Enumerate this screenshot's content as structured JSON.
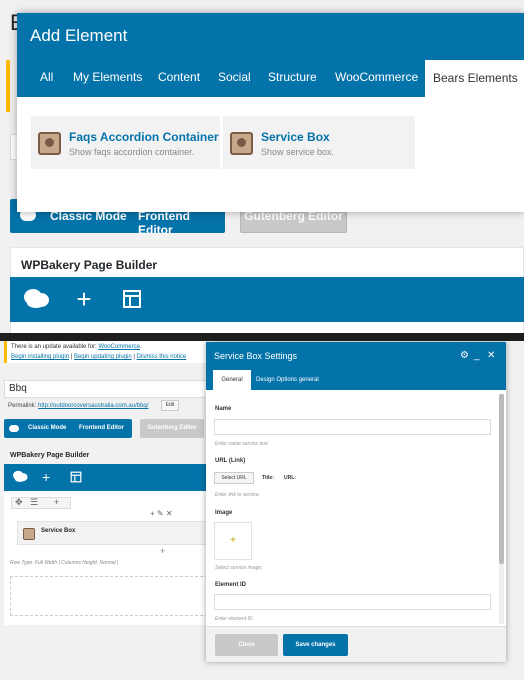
{
  "top": {
    "bg_title": "E",
    "mode_bar": {
      "classic": "Classic Mode",
      "frontend": "Frontend Editor"
    },
    "gutenberg": "Gutenberg Editor",
    "wpbakery_title": "WPBakery Page Builder",
    "toolbar_icons": [
      "cloud-icon",
      "plus-icon",
      "layout-icon"
    ],
    "modal": {
      "title": "Add Element",
      "tabs": [
        "All",
        "My Elements",
        "Content",
        "Social",
        "Structure",
        "WooCommerce",
        "Bears Elements"
      ],
      "active_tab": "Bears Elements",
      "elements": [
        {
          "name": "Faqs Accordion Container",
          "desc": "Show faqs accordion container."
        },
        {
          "name": "Service Box",
          "desc": "Show service box."
        }
      ]
    }
  },
  "bottom": {
    "notice": {
      "line1_prefix": "There is an update available for: ",
      "line1_link": "WooCommerce",
      "line1_suffix": ".",
      "link_install": "Begin installing plugin",
      "link_update": "Begin updating plugin",
      "link_dismiss": "Dismiss this notice"
    },
    "post_title": "Bbq",
    "permalink_label": "Permalink:",
    "permalink_url": "http://outdoorcoversaustralia.com.au/bbq/",
    "edit_label": "Edit",
    "mode_bar": {
      "classic": "Classic Mode",
      "frontend": "Frontend Editor"
    },
    "gutenberg": "Gutenberg Editor",
    "wpbakery_title": "WPBakery Page Builder",
    "element_name": "Service Box",
    "row_info": "Row Type: Full Width | Columns Height: Normal |",
    "dialog": {
      "title": "Service Box Settings",
      "tabs": [
        "General",
        "Design Options general"
      ],
      "fields": {
        "name_label": "Name",
        "name_help": "Enter name service text.",
        "url_label": "URL (Link)",
        "select_url": "Select URL",
        "title_label": "Title:",
        "url_label2": "URL:",
        "url_help": "Enter link to service.",
        "image_label": "Image",
        "image_help": "Select service image.",
        "element_id_label": "Element ID",
        "element_id_help": "Enter element ID ."
      },
      "close_label": "Close",
      "save_label": "Save changes"
    }
  }
}
